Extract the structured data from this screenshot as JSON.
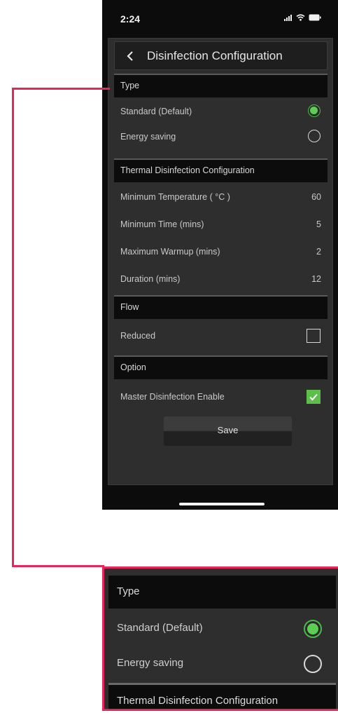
{
  "status_bar": {
    "time": "2:24"
  },
  "nav": {
    "title": "Disinfection Configuration"
  },
  "sections": {
    "type": "Type",
    "thermal": "Thermal Disinfection Configuration",
    "flow": "Flow",
    "option": "Option"
  },
  "type_options": [
    {
      "label": "Standard (Default)",
      "selected": true
    },
    {
      "label": "Energy saving",
      "selected": false
    }
  ],
  "thermal_rows": [
    {
      "label": "Minimum Temperature ( °C )",
      "value": "60"
    },
    {
      "label": "Minimum Time (mins)",
      "value": "5"
    },
    {
      "label": "Maximum Warmup (mins)",
      "value": "2"
    },
    {
      "label": "Duration (mins)",
      "value": "12"
    }
  ],
  "flow": {
    "label": "Reduced",
    "checked": false
  },
  "option": {
    "label": "Master Disinfection Enable",
    "checked": true
  },
  "save_label": "Save",
  "colors": {
    "accent_green": "#5ccf52",
    "callout": "#e5265a",
    "background": "#2e2e2e"
  },
  "icons": [
    "back-chevron-icon",
    "signal-icon",
    "wifi-icon",
    "battery-icon"
  ]
}
